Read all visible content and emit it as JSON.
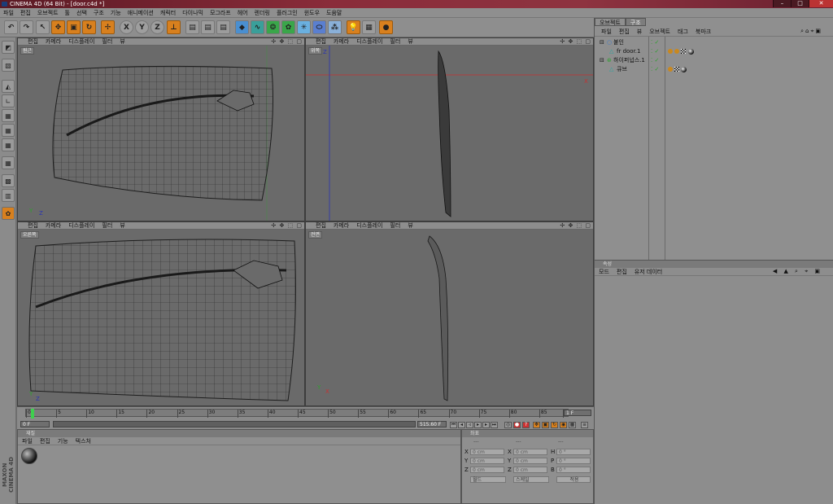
{
  "window": {
    "title": "CINEMA 4D (64 Bit) - [door.c4d *]"
  },
  "menubar": [
    "파일",
    "편집",
    "오브젝트",
    "툴",
    "선택",
    "구조",
    "기능",
    "애니메이션",
    "캐릭터",
    "다이나믹",
    "모그라프",
    "헤어",
    "렌더링",
    "플러그인",
    "윈도우",
    "도움말"
  ],
  "viewport_menu": [
    "편집",
    "카메라",
    "디스플레이",
    "필터",
    "뷰"
  ],
  "viewports": {
    "top_left": {
      "label": "원근"
    },
    "top_right": {
      "label": "위쪽"
    },
    "bottom_left": {
      "label": "오른쪽"
    },
    "bottom_right": {
      "label": "전면"
    }
  },
  "axis_labels": {
    "x": "X",
    "y": "Y",
    "z": "Z"
  },
  "viewport_icons": "✢ ✥ ⬚ ▢",
  "timeline": {
    "ticks": [
      "0",
      "5",
      "10",
      "15",
      "20",
      "25",
      "30",
      "35",
      "40",
      "45",
      "50",
      "55",
      "60",
      "65",
      "70",
      "75",
      "80",
      "85",
      "90"
    ],
    "current_frame": "1 F",
    "start_frame": "0 F",
    "end_frame": "515.60 F"
  },
  "material_panel": {
    "title": "재질",
    "menu": [
      "파일",
      "편집",
      "기능",
      "텍스처"
    ]
  },
  "coord_panel": {
    "title": "좌표",
    "header": [
      "---",
      "---",
      "---"
    ],
    "rows": [
      {
        "a": "X",
        "b": "X",
        "c": "H",
        "v1": "0 cm",
        "v2": "0 cm",
        "v3": "0 °"
      },
      {
        "a": "Y",
        "b": "Y",
        "c": "P",
        "v1": "0 cm",
        "v2": "0 cm",
        "v3": "0 °"
      },
      {
        "a": "Z",
        "b": "Z",
        "c": "B",
        "v1": "0 cm",
        "v2": "0 cm",
        "v3": "0 °"
      }
    ],
    "dropdown1": "월드",
    "dropdown2": "스케일",
    "apply": "적용"
  },
  "object_panel": {
    "tabs": [
      "오브젝트",
      "구조"
    ],
    "menu": [
      "파일",
      "편집",
      "뷰",
      "오브젝트",
      "태그",
      "북마크"
    ],
    "objects": [
      {
        "name": "붙인"
      },
      {
        "name": "fr door.1"
      },
      {
        "name": "하이퍼넙스.1"
      },
      {
        "name": "큐브"
      }
    ]
  },
  "attr_panel": {
    "title": "속성",
    "menu": [
      "모드",
      "편집",
      "유저 데이터"
    ]
  },
  "branding": "MAXON CINEMA 4D",
  "colors": {
    "accent": "#d8801e",
    "x_axis": "#c83030",
    "y_axis": "#2fa02f",
    "z_axis": "#2b34b0"
  }
}
